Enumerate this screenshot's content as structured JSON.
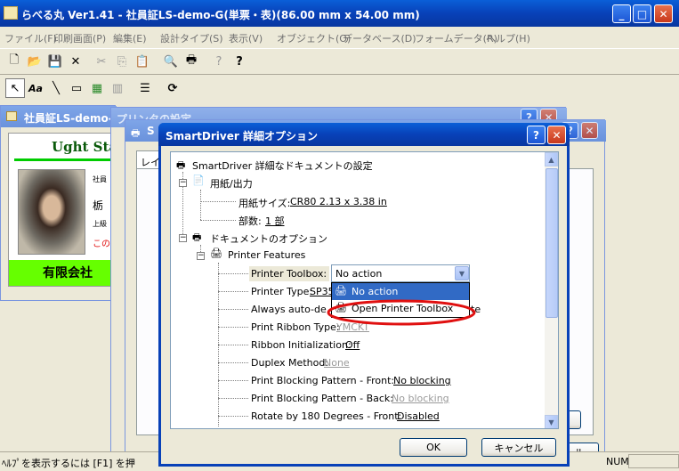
{
  "app": {
    "title": "らべる丸 Ver1.41 - 社員証LS-demo-G(単票・表)(86.00 mm x 54.00 mm)",
    "menu": [
      "ファイル(F)",
      "印刷画面(P)",
      "編集(E)",
      "設計タイプ(S)",
      "表示(V)",
      "オブジェクト(O)",
      "データベース(D)",
      "フォームデータ(R)",
      "ヘルプ(H)"
    ],
    "status_text": "ﾍﾙﾌﾟを表示するには [F1] を押",
    "status_num": "NUM"
  },
  "doc_window": {
    "title": "社員証LS-demo-G",
    "card_company_top": "Ught Sta",
    "card_small_1": "社員",
    "card_small_2": "栃",
    "card_small_3": "上級",
    "card_red_text": "この",
    "card_company": "有限会社"
  },
  "printer_settings_window": {
    "title": "プリンタの設定",
    "tab_label": "レイ"
  },
  "third_window": {
    "title": "S"
  },
  "dialog": {
    "title": "SmartDriver 詳細オプション",
    "help_button": "?",
    "close_button": "X",
    "tree": {
      "root": "SmartDriver 詳細なドキュメントの設定",
      "paper_group": "用紙/出力",
      "paper_size_label": "用紙サイズ:",
      "paper_size_value": "CR80 2.13 x 3.38 in",
      "copies_label": "部数:",
      "copies_value": "1 部",
      "doc_options": "ドキュメントのオプション",
      "printer_features": "Printer Features",
      "toolbox_label": "Printer Toolbox:",
      "toolbox_value": "No action",
      "printer_type_label": "Printer Type:",
      "printer_type_value": "SP35",
      "always_auto_label": "Always auto-de",
      "always_auto_value": "te",
      "ribbon_type_label": "Print Ribbon Type:",
      "ribbon_type_value": "YMCKT",
      "ribbon_init_label": "Ribbon Initialization:",
      "ribbon_init_value": "Off",
      "duplex_label": "Duplex Method:",
      "duplex_value": "None",
      "block_front_label": "Print Blocking Pattern - Front:",
      "block_front_value": "No blocking",
      "block_back_label": "Print Blocking Pattern - Back:",
      "block_back_value": "No blocking",
      "rotate_label": "Rotate by 180 Degrees - Front:",
      "rotate_value": "Disabled"
    },
    "dropdown_options": [
      "No action",
      "Open Printer Toolbox"
    ],
    "ok_label": "OK",
    "cancel_label": "キャンセル"
  },
  "colors": {
    "title_blue": "#0841b8",
    "highlight": "#316ac5",
    "annotation_red": "#e01010",
    "card_green": "#66ff00"
  },
  "bottom_right_button": "ル"
}
